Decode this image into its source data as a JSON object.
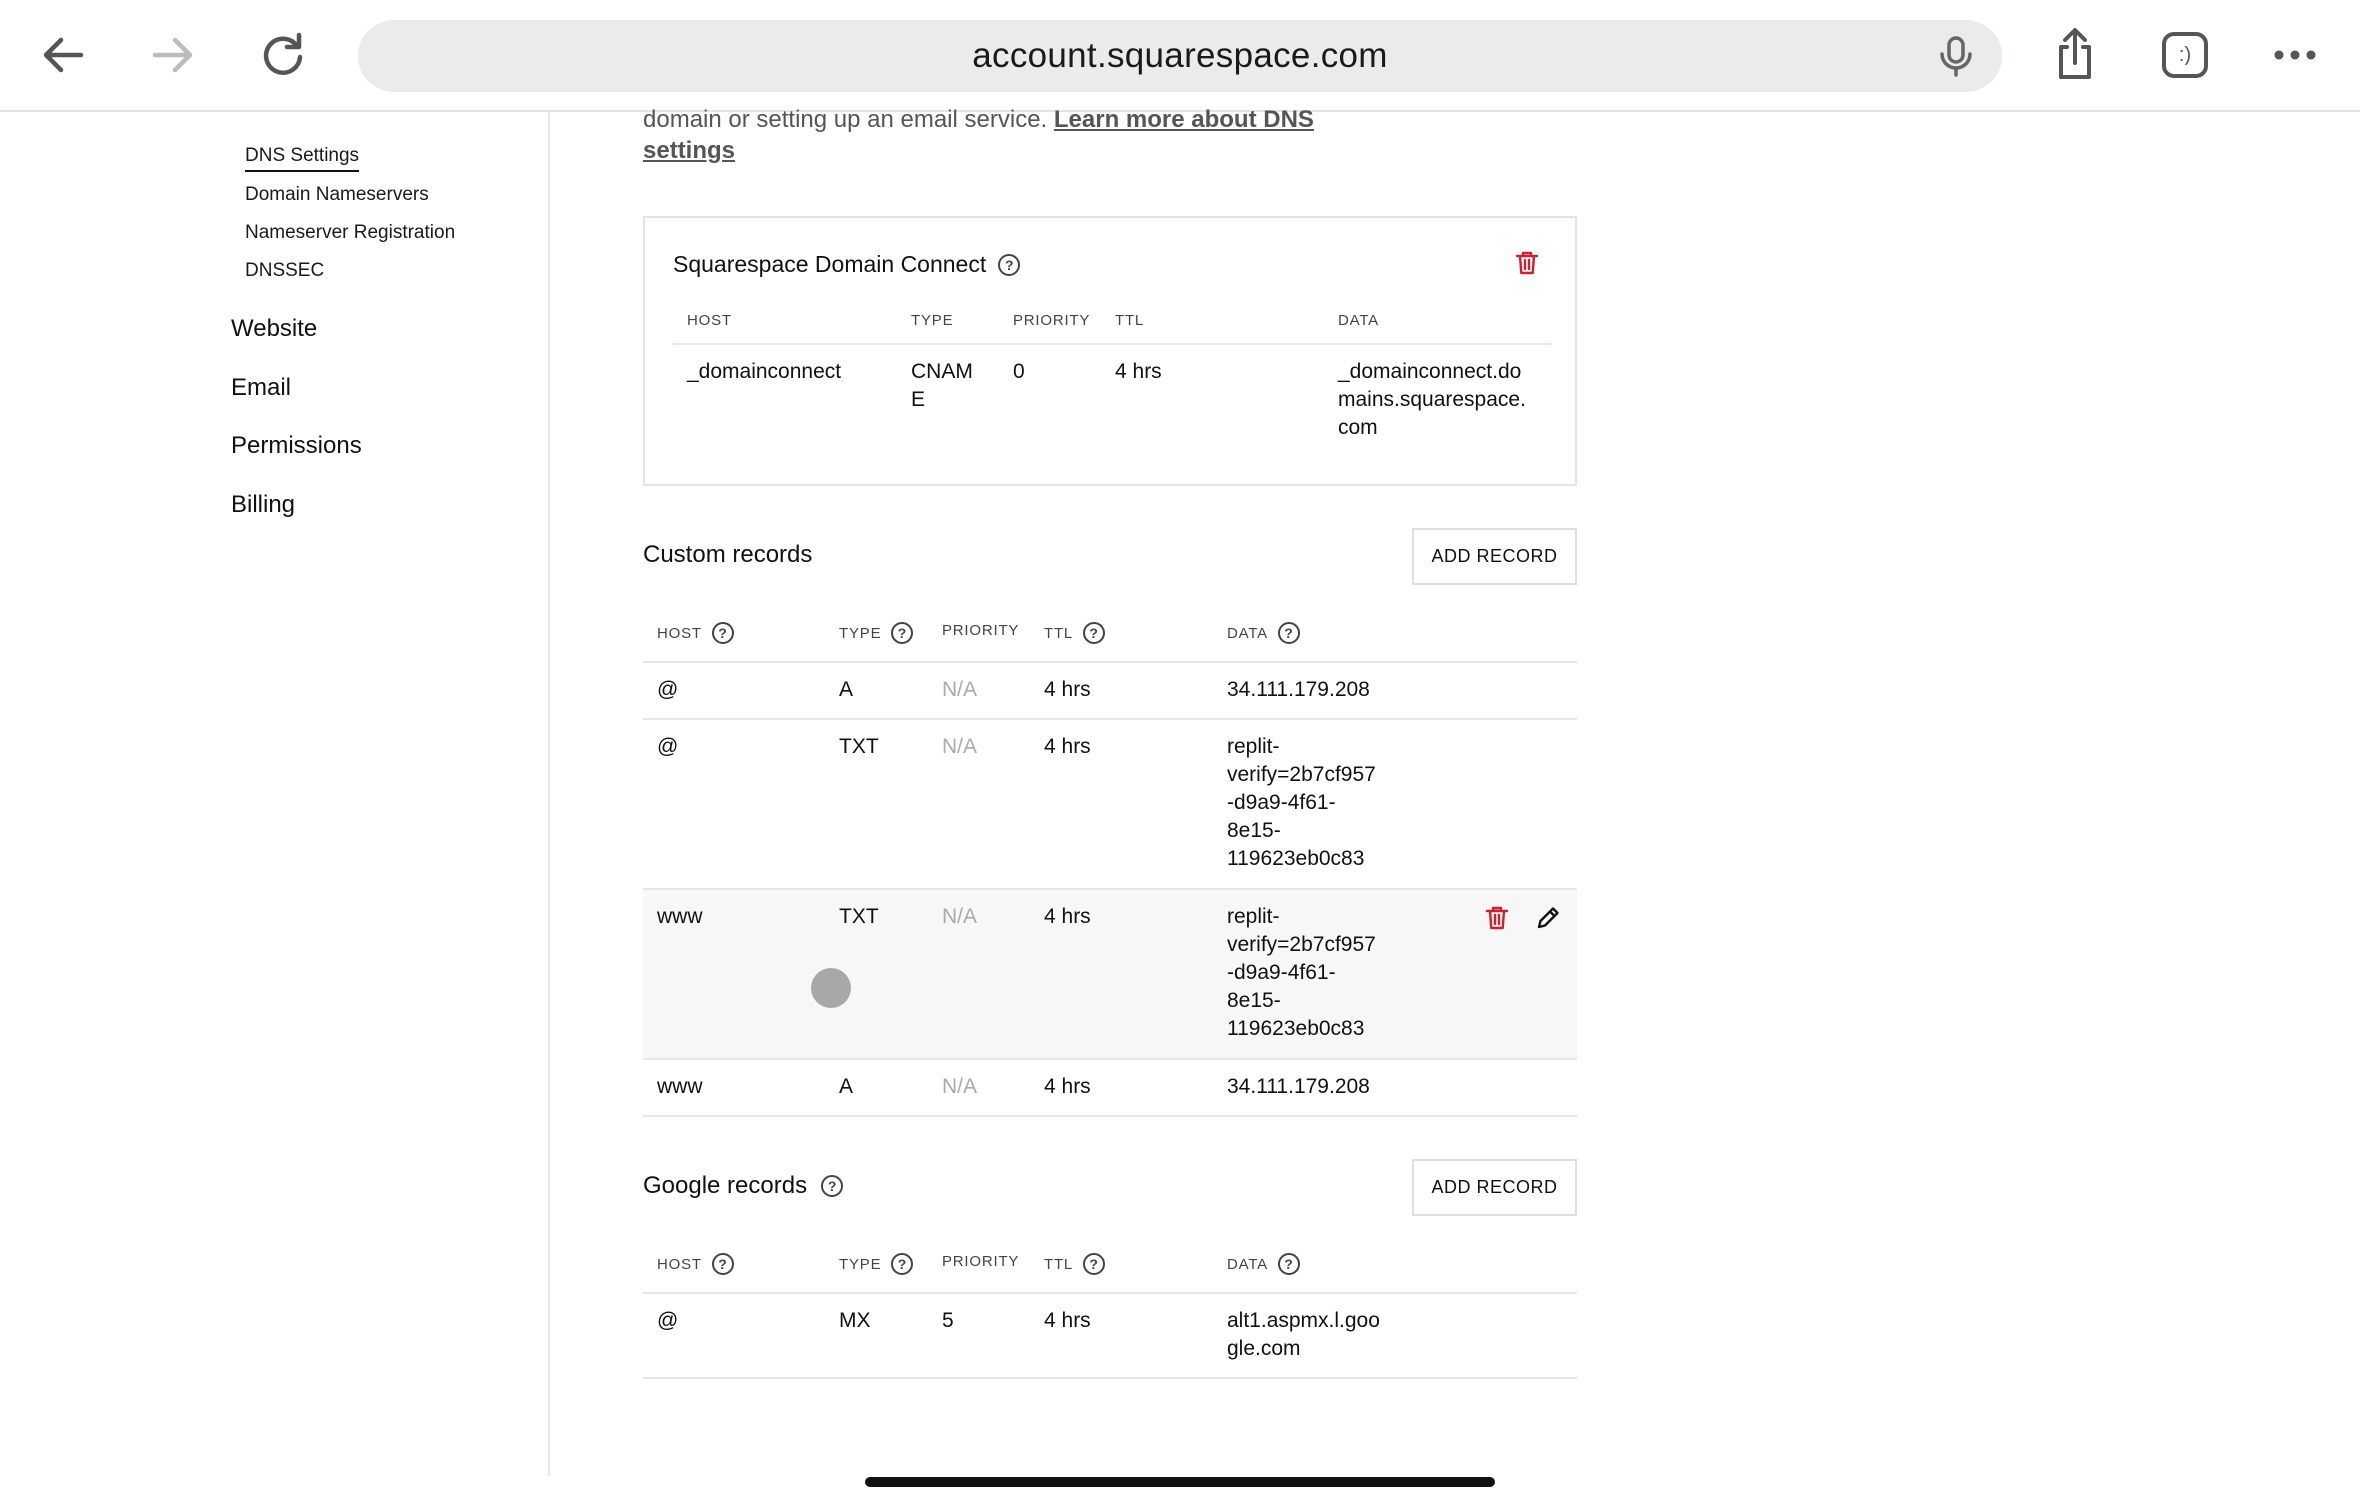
{
  "browser": {
    "url": "account.squarespace.com",
    "tab_icon_label": ":)"
  },
  "sidebar": {
    "sub_items": [
      {
        "label": "DNS Settings",
        "active": true
      },
      {
        "label": "Domain Nameservers"
      },
      {
        "label": "Nameserver Registration"
      },
      {
        "label": "DNSSEC"
      }
    ],
    "main_items": [
      {
        "label": "Website"
      },
      {
        "label": "Email"
      },
      {
        "label": "Permissions"
      },
      {
        "label": "Billing"
      }
    ]
  },
  "intro": {
    "text": "domain or setting up an email service.",
    "link_line1": "Learn more about DNS",
    "link_line2": "settings"
  },
  "domain_connect": {
    "title": "Squarespace Domain Connect",
    "columns": [
      "HOST",
      "TYPE",
      "PRIORITY",
      "TTL",
      "DATA"
    ],
    "row": {
      "host": "_domainconnect",
      "type_line1": "CNAM",
      "type_line2": "E",
      "priority": "0",
      "ttl": "4 hrs",
      "data_line1": "_domainconnect.do",
      "data_line2": "mains.squarespace.",
      "data_line3": "com"
    }
  },
  "custom_records": {
    "title": "Custom records",
    "add_label": "ADD RECORD",
    "columns": [
      "HOST",
      "TYPE",
      "PRIORITY",
      "TTL",
      "DATA"
    ],
    "rows": [
      {
        "host": "@",
        "type": "A",
        "priority": "N/A",
        "ttl": "4 hrs",
        "data": [
          "34.111.179.208"
        ]
      },
      {
        "host": "@",
        "type": "TXT",
        "priority": "N/A",
        "ttl": "4 hrs",
        "data": [
          "replit-",
          "verify=2b7cf957",
          "-d9a9-4f61-",
          "8e15-",
          "119623eb0c83"
        ]
      },
      {
        "host": "www",
        "type": "TXT",
        "priority": "N/A",
        "ttl": "4 hrs",
        "data": [
          "replit-",
          "verify=2b7cf957",
          "-d9a9-4f61-",
          "8e15-",
          "119623eb0c83"
        ]
      },
      {
        "host": "www",
        "type": "A",
        "priority": "N/A",
        "ttl": "4 hrs",
        "data": [
          "34.111.179.208"
        ]
      }
    ]
  },
  "google_records": {
    "title": "Google records",
    "add_label": "ADD RECORD",
    "columns": [
      "HOST",
      "TYPE",
      "PRIORITY",
      "TTL",
      "DATA"
    ],
    "rows": [
      {
        "host": "@",
        "type": "MX",
        "priority": "5",
        "ttl": "4 hrs",
        "data": [
          "alt1.aspmx.l.goo",
          "gle.com"
        ]
      }
    ]
  },
  "icons": {
    "back": "back-arrow-icon",
    "forward": "forward-arrow-icon",
    "reload": "reload-icon",
    "mic": "microphone-icon",
    "share": "share-icon",
    "tab": "tab-icon",
    "more": "more-icon",
    "help": "help-icon",
    "trash": "trash-icon",
    "edit": "pencil-icon"
  },
  "colors": {
    "danger": "#d0202e",
    "link": "#555555",
    "na_text": "#aaaaaa"
  }
}
